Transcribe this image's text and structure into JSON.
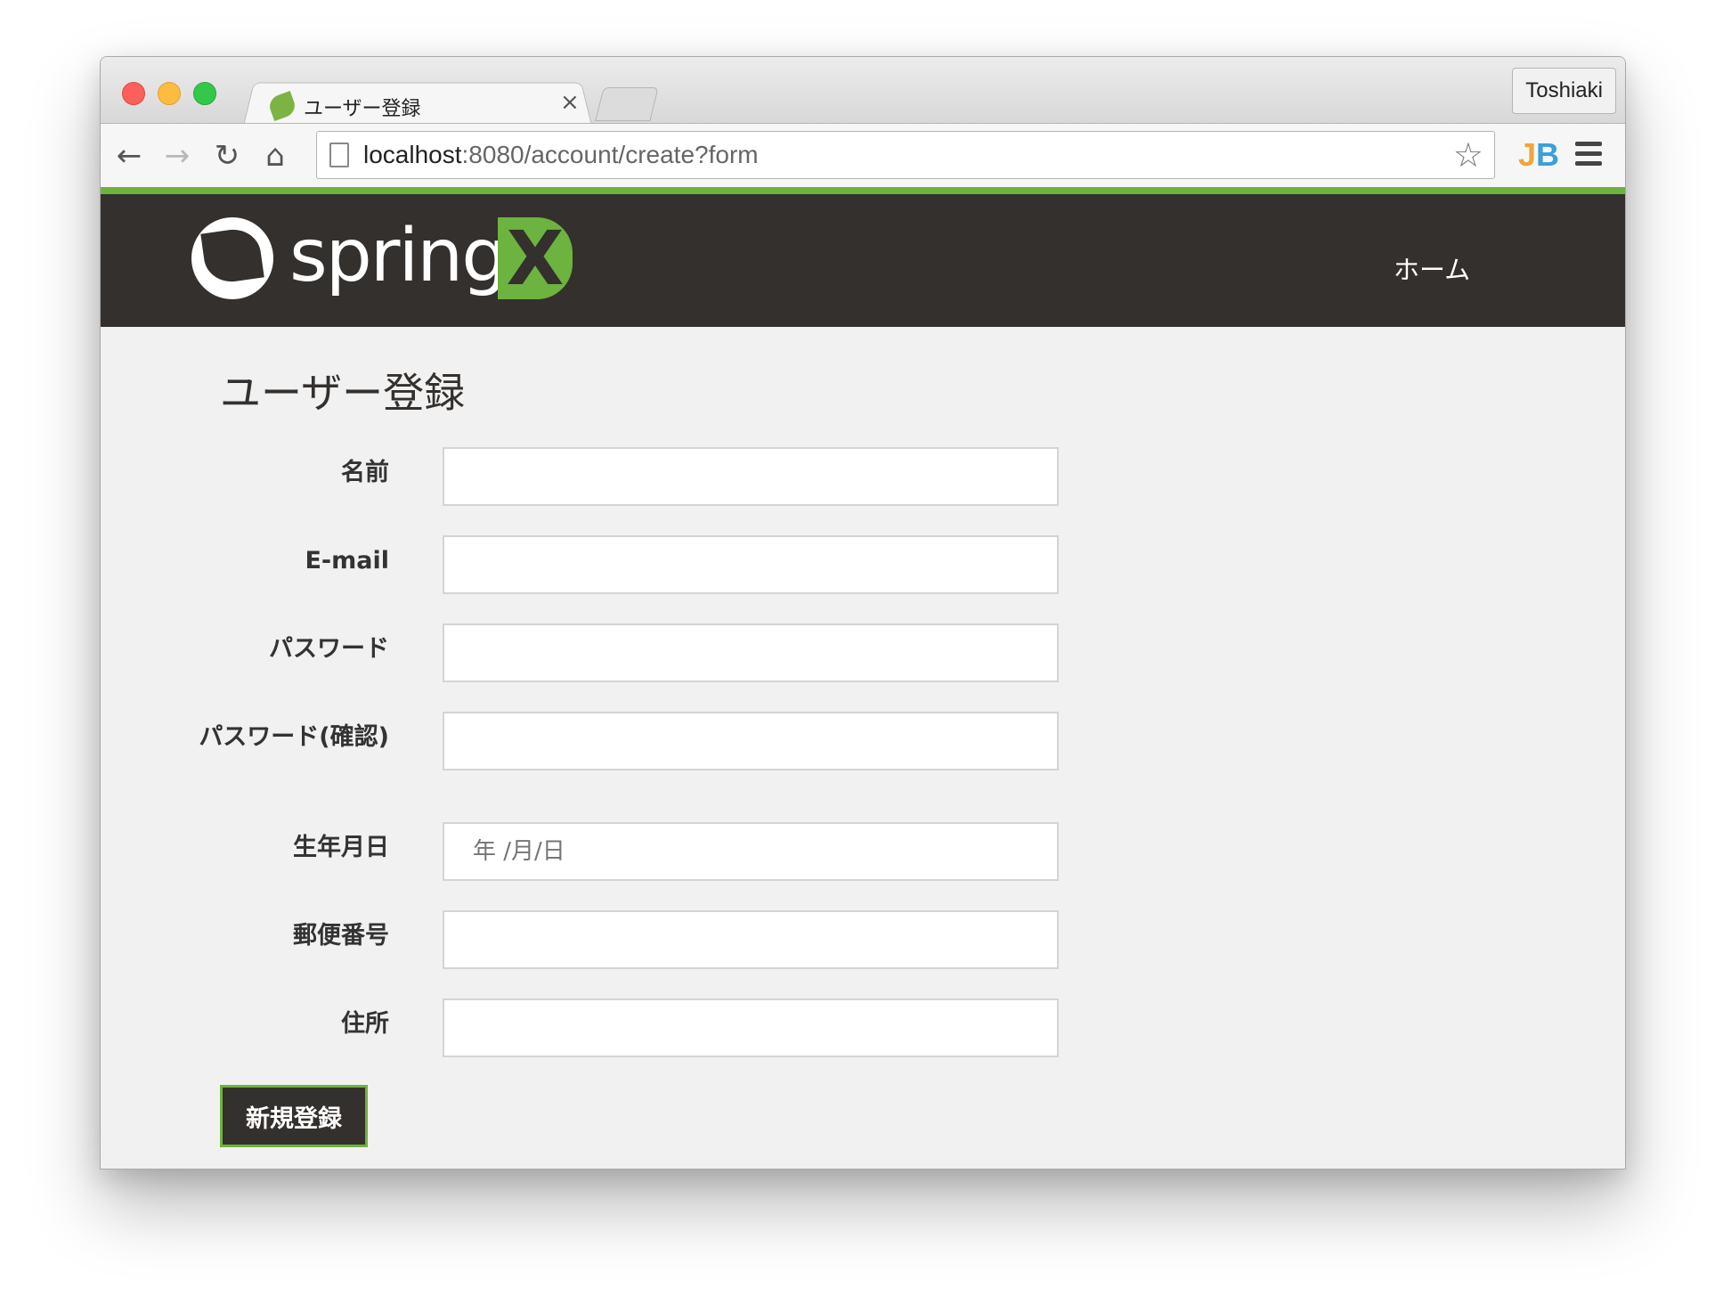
{
  "browser": {
    "tab_title": "ユーザー登録",
    "tab_close": "×",
    "profile_name": "Toshiaki",
    "url_host": "localhost",
    "url_path": ":8080/account/create?form",
    "back_glyph": "←",
    "forward_glyph": "→",
    "reload_glyph": "↻",
    "home_glyph": "⌂",
    "star_glyph": "☆",
    "extension_j": "J",
    "extension_b": "B"
  },
  "header": {
    "logo_text": "spring",
    "logo_x": "X",
    "nav_home": "ホーム",
    "brand_colors": {
      "dark": "#34302d",
      "green": "#6db33f"
    }
  },
  "page": {
    "title": "ユーザー登録",
    "fields": [
      {
        "label": "名前",
        "value": "",
        "type": "text"
      },
      {
        "label": "E-mail",
        "value": "",
        "type": "email"
      },
      {
        "label": "パスワード",
        "value": "",
        "type": "password"
      },
      {
        "label": "パスワード(確認)",
        "value": "",
        "type": "password"
      },
      {
        "label": "生年月日",
        "value": "",
        "placeholder": "年 /月/日",
        "type": "date"
      },
      {
        "label": "郵便番号",
        "value": "",
        "type": "text"
      },
      {
        "label": "住所",
        "value": "",
        "type": "text"
      }
    ],
    "submit_label": "新規登録"
  }
}
